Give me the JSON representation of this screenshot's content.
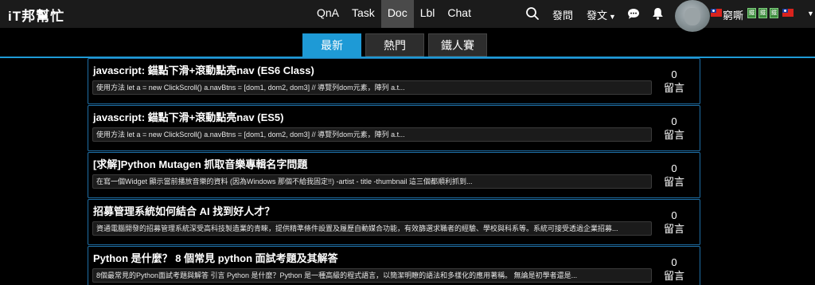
{
  "logo": {
    "text": "iT邦幫忙"
  },
  "nav": {
    "links": [
      {
        "label": "QnA"
      },
      {
        "label": "Task"
      },
      {
        "label": "Doc"
      },
      {
        "label": "Lbl"
      },
      {
        "label": "Chat"
      }
    ],
    "active": "Doc",
    "publish_label": "發問",
    "post_label": "發文",
    "icons": [
      "search-icon",
      "chat-bubble-icon",
      "bell-icon",
      "avatar",
      "taiwan-flag-icon",
      "chevron-down-icon"
    ],
    "username": "窮嘶",
    "badges": [
      "鐵",
      "鐵",
      "鐵"
    ]
  },
  "tabs": [
    {
      "label": "最新"
    },
    {
      "label": "熱門"
    },
    {
      "label": "鐵人賽"
    }
  ],
  "colors": {
    "accent": "#1e9ad6",
    "border": "#1e6fa6",
    "background": "#000000",
    "nav_bg": "#1b1b1b"
  },
  "posts": [
    {
      "title": "javascript: 錨點下滑+滾動點亮nav (ES6 Class)",
      "excerpt": "使用方法 let a = new ClickScroll() a.navBtns = [dom1, dom2, dom3] // 導覽列dom元素，陣列 a.t...",
      "count": "0",
      "count_label": "留言"
    },
    {
      "title": "javascript: 錨點下滑+滾動點亮nav (ES5)",
      "excerpt": "使用方法 let a = new ClickScroll() a.navBtns = [dom1, dom2, dom3] // 導覽列dom元素，陣列 a.t...",
      "count": "0",
      "count_label": "留言"
    },
    {
      "title": "[求解]Python Mutagen 抓取音樂專輯名字問題",
      "excerpt": "在寫一個Widget 顯示當前播放音樂的資料 (因為Windows 那個不給我固定!!) -artist - title -thumbnail 這三個都順利抓到...",
      "count": "0",
      "count_label": "留言"
    },
    {
      "title": "招募管理系統如何結合 AI 找到好人才？",
      "excerpt": "資通電腦開發的招募管理系統深受高科技製造業的青睞，提供精準條件設置及履歷自動媒合功能，有效篩選求職者的經驗、學校與科系等。系統可接受透過企業招募...",
      "count": "0",
      "count_label": "留言"
    },
    {
      "title": "Python 是什麼？ 8 個常見 python 面試考題及其解答",
      "excerpt": "8個最常見的Python面試考題與解答 引言 Python 是什麼？Python 是一種高級的程式語言，以簡潔明瞭的語法和多樣化的應用著稱。 無論是初學者還是...",
      "count": "0",
      "count_label": "留言"
    }
  ]
}
